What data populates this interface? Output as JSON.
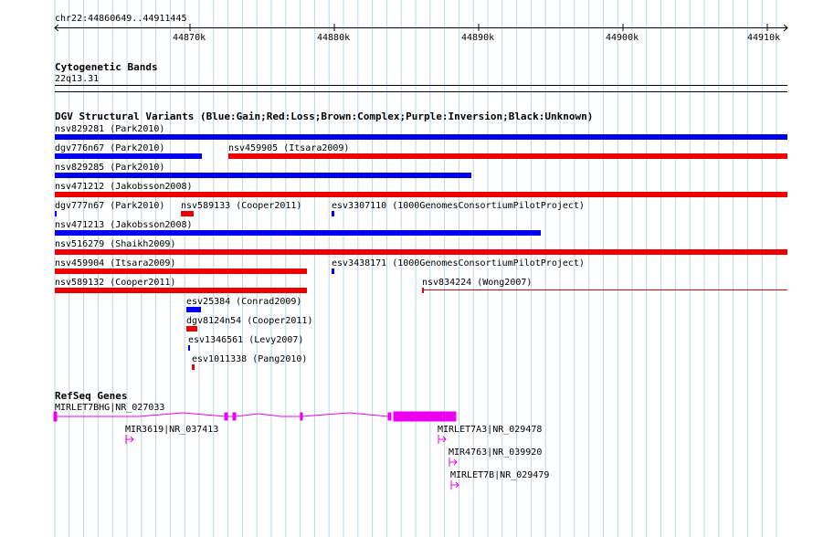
{
  "ruler": {
    "region": "chr22:44860649..44911445",
    "ticks": [
      "44870k",
      "44880k",
      "44890k",
      "44900k",
      "44910k"
    ]
  },
  "cytoband": {
    "title": "Cytogenetic Bands",
    "band": "22q13.31"
  },
  "dgv": {
    "title": "DGV Structural Variants (Blue:Gain;Red:Loss;Brown:Complex;Purple:Inversion;Black:Unknown)",
    "colors": {
      "gain": "#0000ee",
      "loss": "#ee0000"
    },
    "features": [
      {
        "label": "nsv829281 (Park2010)",
        "type": "gain"
      },
      {
        "label": "dgv776n67 (Park2010)",
        "type": "gain"
      },
      {
        "label": "nsv459905 (Itsara2009)",
        "type": "loss"
      },
      {
        "label": "nsv829285 (Park2010)",
        "type": "gain"
      },
      {
        "label": "nsv471212 (Jakobsson2008)",
        "type": "loss"
      },
      {
        "label": "dgv777n67 (Park2010)",
        "type": "gain"
      },
      {
        "label": "nsv589133 (Cooper2011)",
        "type": "loss"
      },
      {
        "label": "esv3307110 (1000GenomesConsortiumPilotProject)",
        "type": "gain"
      },
      {
        "label": "nsv471213 (Jakobsson2008)",
        "type": "gain"
      },
      {
        "label": "nsv516279 (Shaikh2009)",
        "type": "loss"
      },
      {
        "label": "nsv459904 (Itsara2009)",
        "type": "loss"
      },
      {
        "label": "esv3438171 (1000GenomesConsortiumPilotProject)",
        "type": "gain"
      },
      {
        "label": "nsv589132 (Cooper2011)",
        "type": "loss"
      },
      {
        "label": "nsv834224 (Wong2007)",
        "type": "loss"
      },
      {
        "label": "esv25384 (Conrad2009)",
        "type": "gain"
      },
      {
        "label": "dgv8124n54 (Cooper2011)",
        "type": "loss"
      },
      {
        "label": "esv1346561 (Levy2007)",
        "type": "gain"
      },
      {
        "label": "esv1011338 (Pang2010)",
        "type": "loss"
      }
    ]
  },
  "refseq": {
    "title": "RefSeq Genes",
    "color": "#ee00ee",
    "genes": [
      {
        "label": "MIRLET7BHG|NR_027033"
      },
      {
        "label": "MIR3619|NR_037413"
      },
      {
        "label": "MIRLET7A3|NR_029478"
      },
      {
        "label": "MIR4763|NR_039920"
      },
      {
        "label": "MIRLET7B|NR_029479"
      }
    ]
  }
}
